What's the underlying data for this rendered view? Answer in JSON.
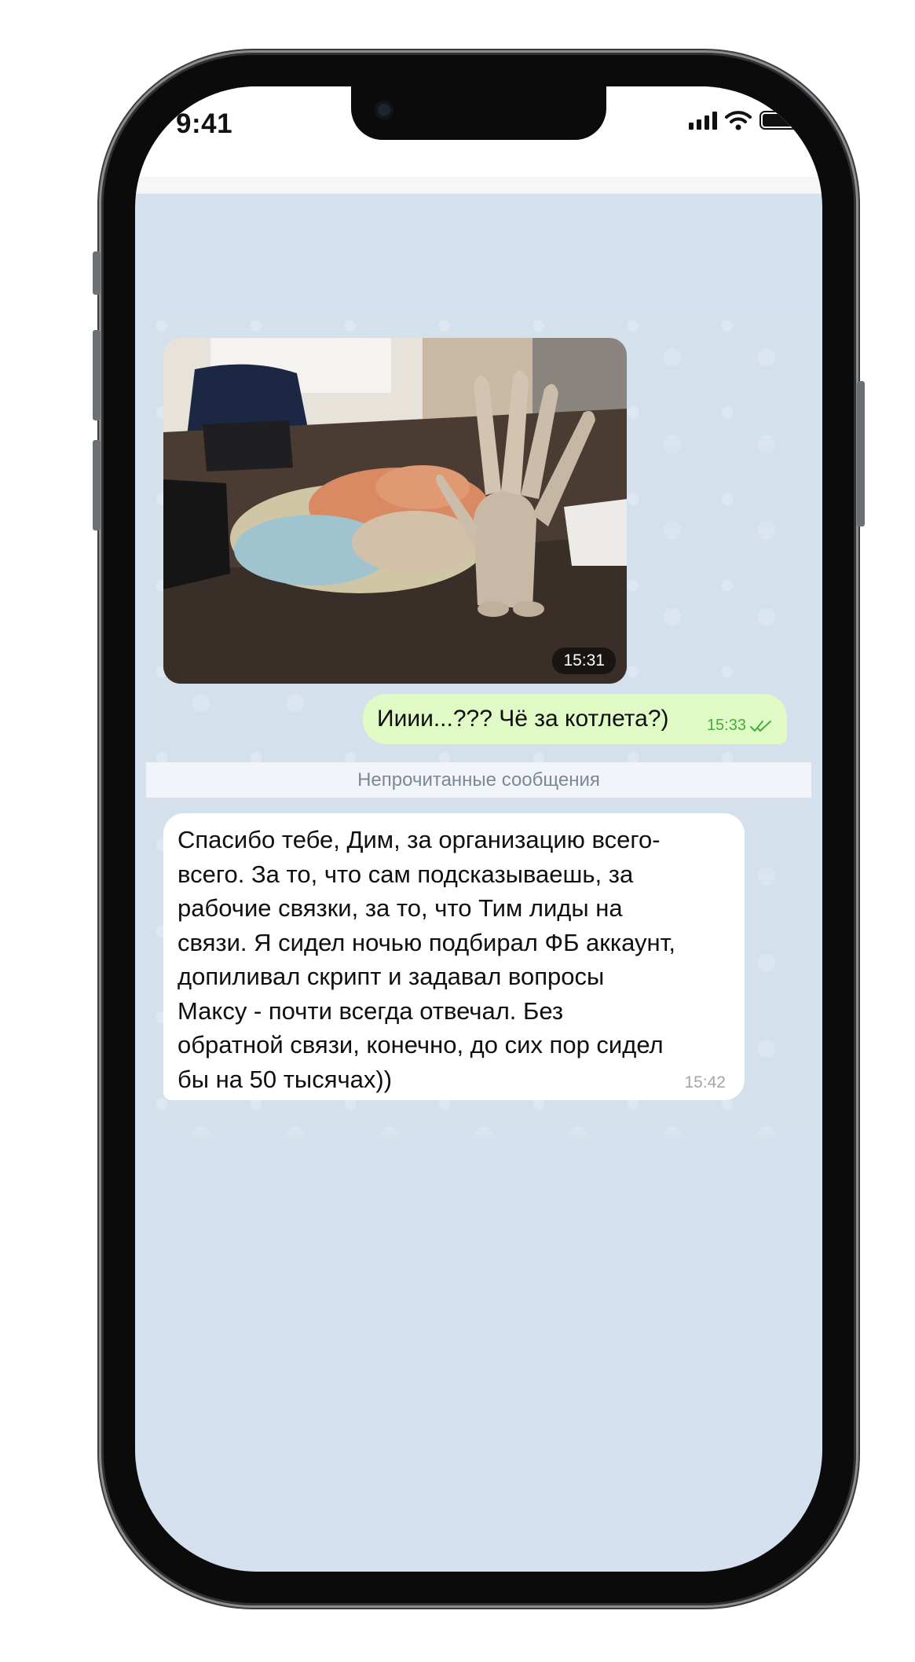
{
  "status_bar": {
    "time": "9:41",
    "icons": [
      "cellular-signal-icon",
      "wifi-icon",
      "battery-icon"
    ]
  },
  "chat": {
    "messages": [
      {
        "type": "photo",
        "direction": "incoming",
        "time": "15:31"
      },
      {
        "type": "text",
        "direction": "outgoing",
        "text": "Ииии...??? Чё за котлета?)",
        "time": "15:33",
        "status_icon": "double-check-icon"
      },
      {
        "type": "text",
        "direction": "incoming",
        "text": "Спасибо тебе, Дим, за организацию всего-\nвсего. За то, что сам подсказываешь, за\nрабочие связки, за то, что Тим лиды на\nсвязи. Я сидел ночью подбирал ФБ аккаунт,\nдопиливал скрипт и задавал вопросы\nМаксу - почти всегда отвечал. Без\nобратной связи, конечно, до сих пор сидел\nбы на 50 тысячах))",
        "time": "15:42"
      }
    ],
    "unread_separator": "Непрочитанные сообщения"
  },
  "colors": {
    "chat_background": "#d4e0ec",
    "outgoing_bubble": "#e0fac6",
    "incoming_bubble": "#ffffff",
    "read_check": "#45ad3a"
  }
}
